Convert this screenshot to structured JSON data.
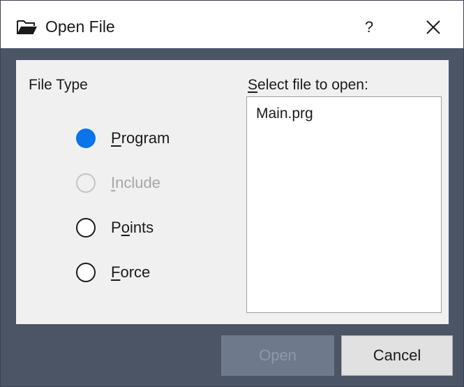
{
  "window": {
    "title": "Open File",
    "help_label": "?",
    "icons": {
      "title": "folder-open-icon",
      "close": "close-icon"
    }
  },
  "file_type": {
    "label": "File Type",
    "selected": "Program",
    "options": [
      {
        "pre": "",
        "key": "P",
        "post": "rogram",
        "state": "checked"
      },
      {
        "pre": "",
        "key": "I",
        "post": "nclude",
        "state": "disabled"
      },
      {
        "pre": "P",
        "key": "o",
        "post": "ints",
        "state": "unchecked"
      },
      {
        "pre": "",
        "key": "F",
        "post": "orce",
        "state": "unchecked"
      }
    ]
  },
  "file_list": {
    "label_key": "S",
    "label_rest": "elect file to open:",
    "items": [
      "Main.prg"
    ]
  },
  "buttons": {
    "open": "Open",
    "cancel": "Cancel"
  },
  "colors": {
    "accent": "#0a74e8",
    "frame": "#4b5566",
    "panel": "#f0f0f0"
  }
}
